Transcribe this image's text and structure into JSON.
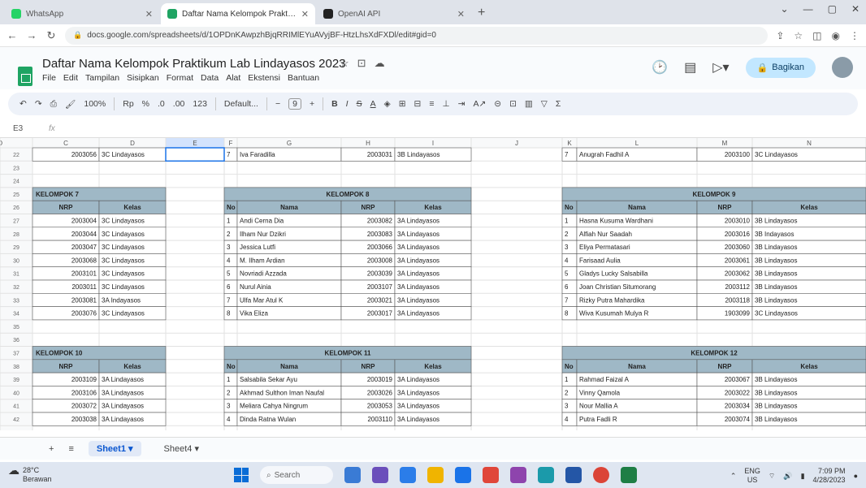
{
  "browser": {
    "tabs": [
      {
        "label": "WhatsApp",
        "color": "#25d366",
        "active": false
      },
      {
        "label": "Daftar Nama Kelompok Praktikum...",
        "color": "#1fa463",
        "active": true
      },
      {
        "label": "OpenAI API",
        "color": "#222222",
        "active": false
      }
    ],
    "newtab": "+",
    "url": "docs.google.com/spreadsheets/d/1OPDnKAwpzhBjqRRIMlEYuAVyjBF-HtzLhsXdFXDl/edit#gid=0"
  },
  "doc": {
    "title": "Daftar Nama Kelompok Praktikum Lab Lindayasos 2023",
    "menus": [
      "File",
      "Edit",
      "Tampilan",
      "Sisipkan",
      "Format",
      "Data",
      "Alat",
      "Ekstensi",
      "Bantuan"
    ],
    "share_label": "Bagikan"
  },
  "toolbar": {
    "zoom": "100%",
    "font": "Default...",
    "font_size": "9",
    "currency": "Rp",
    "percent": "%"
  },
  "formula": {
    "cell": "E3",
    "fx": "fx"
  },
  "grid": {
    "columns": [
      "C",
      "D",
      "E",
      "F",
      "G",
      "H",
      "I",
      "J",
      "K",
      "L",
      "M",
      "N",
      "O"
    ],
    "rows": [
      "22",
      "23",
      "24",
      "25",
      "26",
      "27",
      "28",
      "29",
      "30",
      "31",
      "32",
      "33",
      "34",
      "35",
      "36",
      "37",
      "38",
      "39",
      "40",
      "41",
      "42"
    ],
    "top_rows": [
      {
        "nrp": "2003056",
        "kelas": "3C Lindayasos"
      },
      {
        "no": "7",
        "nama": "Iva Faradilla",
        "nrp": "2003031",
        "kelas": "3B Lindayasos"
      },
      {
        "no": "7",
        "nama": "Anugrah Fadhil A",
        "nrp": "2003100",
        "kelas": "3C Lindayasos"
      }
    ],
    "groups": [
      {
        "title": "KELOMPOK 7",
        "partial": true,
        "headers": {
          "nrp": "NRP",
          "kelas": "Kelas"
        },
        "rows": [
          {
            "nrp": "2003004",
            "kelas": "3C Lindayasos"
          },
          {
            "nrp": "2003044",
            "kelas": "3C Lindayasos"
          },
          {
            "nrp": "2003047",
            "kelas": "3C Lindayasos"
          },
          {
            "nrp": "2003068",
            "kelas": "3C Lindayasos"
          },
          {
            "nrp": "2003101",
            "kelas": "3C Lindayasos"
          },
          {
            "nrp": "2003011",
            "kelas": "3C Lindayasos"
          },
          {
            "nrp": "2003081",
            "kelas": "3A Indayasos"
          },
          {
            "nrp": "2003076",
            "kelas": "3C Lindayasos"
          }
        ]
      },
      {
        "title": "KELOMPOK 8",
        "headers": {
          "no": "No",
          "nama": "Nama",
          "nrp": "NRP",
          "kelas": "Kelas"
        },
        "rows": [
          {
            "no": "1",
            "nama": "Andi Cerna Dia",
            "nrp": "2003082",
            "kelas": "3A Lindayasos"
          },
          {
            "no": "2",
            "nama": "Ilham Nur Dzikri",
            "nrp": "2003083",
            "kelas": "3A Lindayasos"
          },
          {
            "no": "3",
            "nama": "Jessica Lutfi",
            "nrp": "2003066",
            "kelas": "3A Lindayasos"
          },
          {
            "no": "4",
            "nama": "M. Ilham Ardian",
            "nrp": "2003008",
            "kelas": "3A Lindayasos"
          },
          {
            "no": "5",
            "nama": "Novriadi Azzada",
            "nrp": "2003039",
            "kelas": "3A Lindayasos"
          },
          {
            "no": "6",
            "nama": "Nurul Ainia",
            "nrp": "2003107",
            "kelas": "3A Lindayasos"
          },
          {
            "no": "7",
            "nama": "Ulfa Mar Atul K",
            "nrp": "2003021",
            "kelas": "3A Lindayasos"
          },
          {
            "no": "8",
            "nama": "Vika Eliza",
            "nrp": "2003017",
            "kelas": "3A Lindayasos"
          }
        ]
      },
      {
        "title": "KELOMPOK 9",
        "headers": {
          "no": "No",
          "nama": "Nama",
          "nrp": "NRP",
          "kelas": "Kelas"
        },
        "rows": [
          {
            "no": "1",
            "nama": "Hasna Kusuma Wardhani",
            "nrp": "2003010",
            "kelas": "3B Lindayasos"
          },
          {
            "no": "2",
            "nama": "Alfiah Nur Saadah",
            "nrp": "2003016",
            "kelas": "3B Indayasos"
          },
          {
            "no": "3",
            "nama": "Eliya Permatasari",
            "nrp": "2003060",
            "kelas": "3B Lindayasos"
          },
          {
            "no": "4",
            "nama": "Farisaad Aulia",
            "nrp": "2003061",
            "kelas": "3B Lindayasos"
          },
          {
            "no": "5",
            "nama": "Gladys Lucky Salsabilla",
            "nrp": "2003062",
            "kelas": "3B Lindayasos"
          },
          {
            "no": "6",
            "nama": "Joan Christian Situmorang",
            "nrp": "2003112",
            "kelas": "3B Lindayasos"
          },
          {
            "no": "7",
            "nama": "Rizky Putra Mahardika",
            "nrp": "2003118",
            "kelas": "3B Lindayasos"
          },
          {
            "no": "8",
            "nama": "Wiva Kusumah Mulya R",
            "nrp": "1903099",
            "kelas": "3C Lindayasos"
          }
        ]
      },
      {
        "title": "KELOMPOK 10",
        "partial": true,
        "headers": {
          "nrp": "NRP",
          "kelas": "Kelas"
        },
        "rows": [
          {
            "nrp": "2003109",
            "kelas": "3A Lindayasos"
          },
          {
            "nrp": "2003106",
            "kelas": "3A Lindayasos"
          },
          {
            "nrp": "2003072",
            "kelas": "3A Lindayasos"
          },
          {
            "nrp": "2003038",
            "kelas": "3A Lindayasos"
          }
        ]
      },
      {
        "title": "KELOMPOK 11",
        "headers": {
          "no": "No",
          "nama": "Nama",
          "nrp": "NRP",
          "kelas": "Kelas"
        },
        "rows": [
          {
            "no": "1",
            "nama": "Salsabila Sekar Ayu",
            "nrp": "2003019",
            "kelas": "3A Lindayasos"
          },
          {
            "no": "2",
            "nama": "Akhmad Sulthon Iman Naufal",
            "nrp": "2003026",
            "kelas": "3A Lindayasos"
          },
          {
            "no": "3",
            "nama": "Meliara Cahya Ningrum",
            "nrp": "2003053",
            "kelas": "3A Lindayasos"
          },
          {
            "no": "4",
            "nama": "Dinda Ratna Wulan",
            "nrp": "2003110",
            "kelas": "3A Lindayasos"
          }
        ]
      },
      {
        "title": "KELOMPOK 12",
        "headers": {
          "no": "No",
          "nama": "Nama",
          "nrp": "NRP",
          "kelas": "Kelas"
        },
        "rows": [
          {
            "no": "1",
            "nama": "Rahmad Faizal A",
            "nrp": "2003067",
            "kelas": "3B Lindayasos"
          },
          {
            "no": "2",
            "nama": "Vinny Qamola",
            "nrp": "2003022",
            "kelas": "3B Lindayasos"
          },
          {
            "no": "3",
            "nama": "Nour Mallia A",
            "nrp": "2003034",
            "kelas": "3B Lindayasos"
          },
          {
            "no": "4",
            "nama": "Putra Fadli R",
            "nrp": "2003074",
            "kelas": "3B Lindayasos"
          }
        ]
      }
    ]
  },
  "sheets": {
    "tabs": [
      "Sheet1",
      "Sheet4"
    ],
    "active": "Sheet1"
  },
  "taskbar": {
    "weather_temp": "28°C",
    "weather_desc": "Berawan",
    "search": "Search",
    "lang": "ENG",
    "region": "US",
    "time": "7:09 PM",
    "date": "4/28/2023"
  },
  "colors": {
    "header_fill": "#9fb8c6",
    "accent": "#1fa463",
    "share": "#c2e7ff"
  }
}
